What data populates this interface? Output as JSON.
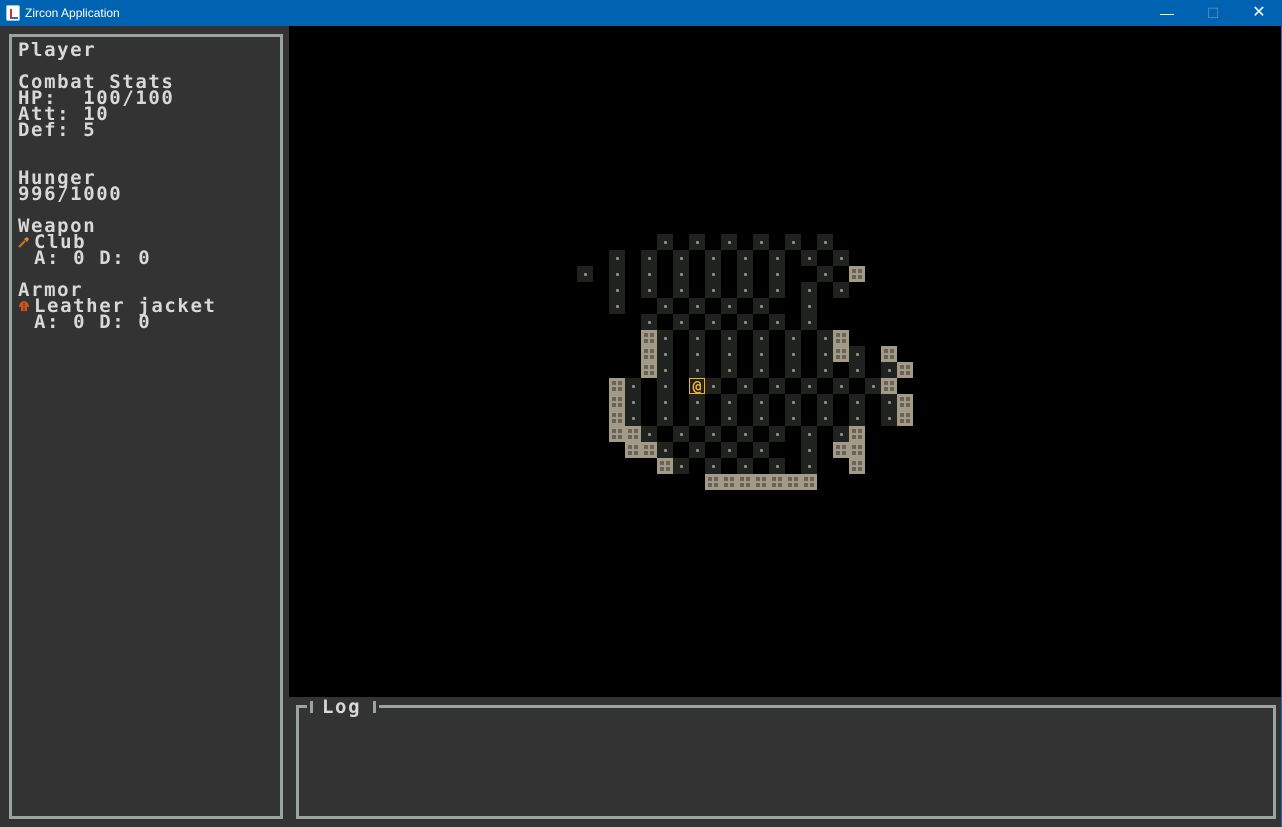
{
  "window": {
    "title": "Zircon Application",
    "minimize_glyph": "—",
    "maximize_glyph": "☐",
    "close_glyph": "✕"
  },
  "player_panel": {
    "heading": "Player",
    "combat_heading": "Combat Stats",
    "hp": "HP:  100/100",
    "att": "Att: 10",
    "def": "Def: 5",
    "hunger_heading": "Hunger",
    "hunger_value": "996/1000",
    "weapon_heading": "Weapon",
    "weapon_icon": "club-icon",
    "weapon_name": "Club",
    "weapon_stats": "A: 0 D: 0",
    "armor_heading": "Armor",
    "armor_icon": "jacket-icon",
    "armor_name": "Leather jacket",
    "armor_stats": "A: 0 D: 0"
  },
  "log": {
    "title": "Log",
    "entries": []
  },
  "map": {
    "player_glyph": "@",
    "player_color": "#f1b328",
    "rows": [
      "...F.F.F.F.F.F...",
      ".F.F.F.F.F.F.F.F.",
      "F.F.F.F.F.F.F..F.W",
      ".F.F.F.F.F.F.F.F.",
      ".F..F.F.F.F..F.",
      "..F.F.F.F.F.F.",
      "..WF.F.F.F.F.FW",
      "..WF.F.F.F.F.FWF.W",
      "..WF.F.F.F.F.F.F.FW",
      ".WF.F.@F.F.F.F.F.FW",
      ".WF.F.F.F.F.F.F.F.FW",
      ".WF.F.F.F.F.F.F.F.FW",
      ".WWF.F.F.F.F.F.FW",
      "..WWF.F.F.F..F.WW",
      "...WF.F.F.F.F..W",
      "....WWWWWWW"
    ]
  }
}
